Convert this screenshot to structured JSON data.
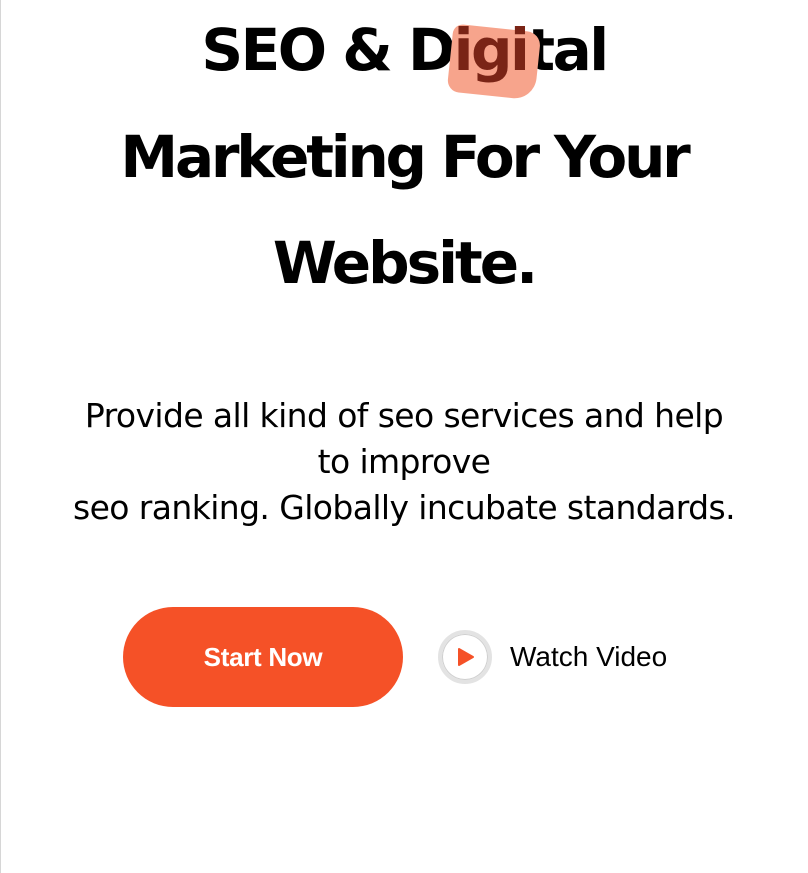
{
  "hero": {
    "title": {
      "line1_prefix": "SEO & D",
      "line1_highlight": "igi",
      "line1_suffix": "tal",
      "line2": "Marketing For Your",
      "line3": "Website."
    },
    "subtitle": {
      "line1": "Provide all kind of seo services and help",
      "line2": "to improve",
      "line3": "seo ranking. Globally incubate standards."
    },
    "cta": {
      "start_label": "Start Now",
      "watch_label": "Watch Video"
    }
  },
  "icons": {
    "play": "play-icon"
  },
  "colors": {
    "accent": "#f55127",
    "highlight": "#f7a48c",
    "highlight_text": "#7a2416",
    "text": "#000000",
    "background": "#ffffff"
  }
}
